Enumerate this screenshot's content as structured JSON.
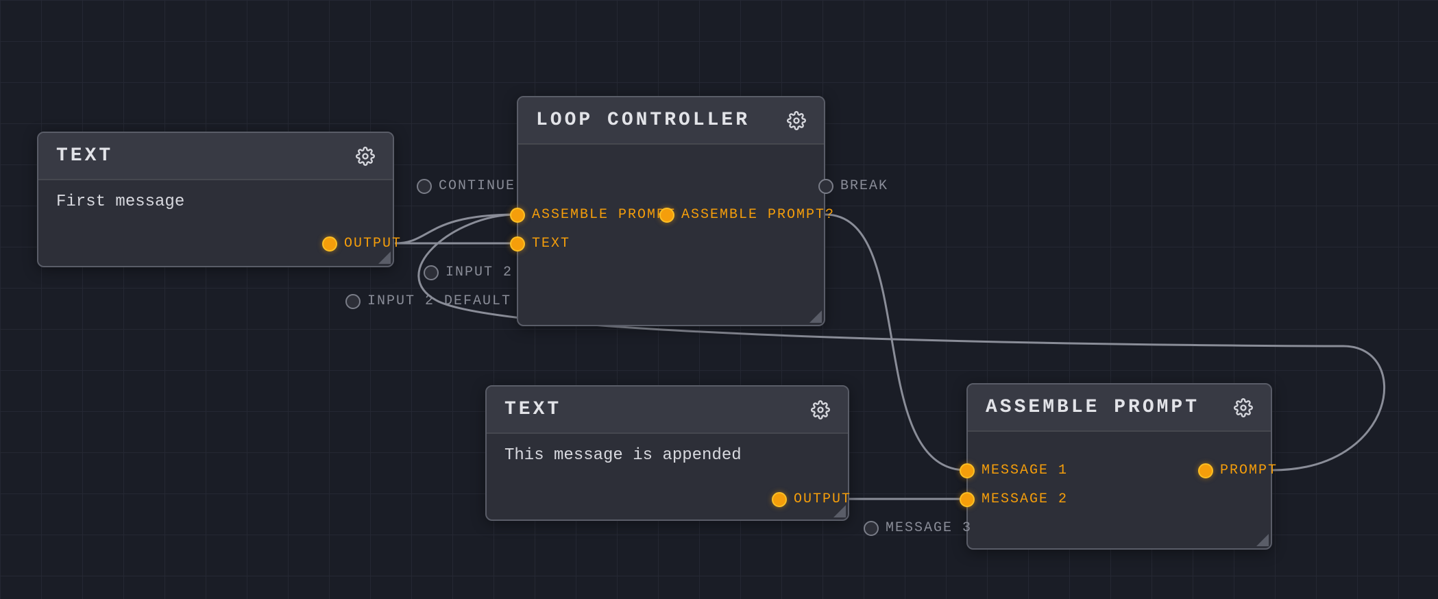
{
  "colors": {
    "accent": "#f59e0b",
    "bg": "#1a1d26",
    "node_bg": "#2d2f38",
    "node_header": "#383a44"
  },
  "nodes": {
    "text1": {
      "title": "TEXT",
      "content": "First message",
      "outputs": {
        "output": "OUTPUT"
      }
    },
    "loop": {
      "title": "LOOP CONTROLLER",
      "inputs": {
        "continue": "CONTINUE",
        "assemble_prompt": "ASSEMBLE PROMPT",
        "text": "TEXT",
        "input2": "INPUT 2",
        "input2_default": "INPUT 2 DEFAULT"
      },
      "outputs": {
        "break": "BREAK",
        "assemble_prompt_q": "ASSEMBLE PROMPT?"
      }
    },
    "text2": {
      "title": "TEXT",
      "content": "This message is appended",
      "outputs": {
        "output": "OUTPUT"
      }
    },
    "assemble": {
      "title": "ASSEMBLE PROMPT",
      "inputs": {
        "message1": "MESSAGE 1",
        "message2": "MESSAGE 2",
        "message3": "MESSAGE 3"
      },
      "outputs": {
        "prompt": "PROMPT"
      }
    }
  }
}
